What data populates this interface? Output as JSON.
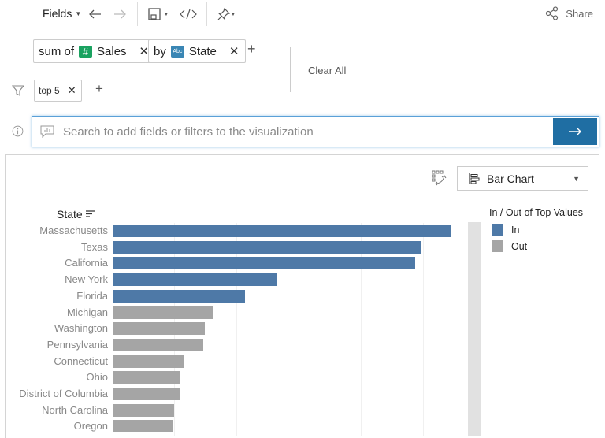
{
  "toolbar": {
    "fields_label": "Fields",
    "share_label": "Share"
  },
  "query": {
    "measure_chip": {
      "prefix": "sum of",
      "field": "Sales",
      "field_type_icon": "number-hash-icon",
      "color": "#1aa260"
    },
    "dimension_chip": {
      "prefix": "by",
      "field": "State",
      "field_type_icon": "abc-text-icon",
      "color": "#3a86b4"
    },
    "filter_chip": {
      "label": "top 5"
    },
    "clear_all_label": "Clear All"
  },
  "search": {
    "placeholder": "Search to add fields or filters to the visualization",
    "value": ""
  },
  "chart_controls": {
    "chart_type": "Bar Chart"
  },
  "colors": {
    "in": "#4e79a7",
    "out": "#a5a5a5",
    "accent": "#1f6ea3"
  },
  "chart_data": {
    "type": "bar",
    "orientation": "horizontal",
    "ylabel": "State",
    "xlabel": "",
    "categories": [
      "Massachusetts",
      "Texas",
      "California",
      "New York",
      "Florida",
      "Michigan",
      "Washington",
      "Pennsylvania",
      "Connecticut",
      "Ohio",
      "District of Columbia",
      "North Carolina",
      "Oregon"
    ],
    "values": [
      5.43,
      4.96,
      4.86,
      2.63,
      2.13,
      1.61,
      1.48,
      1.46,
      1.14,
      1.09,
      1.08,
      0.99,
      0.96
    ],
    "value_units": "relative (gridline steps; axis tick labels not visible)",
    "groups": [
      "In",
      "In",
      "In",
      "In",
      "In",
      "Out",
      "Out",
      "Out",
      "Out",
      "Out",
      "Out",
      "Out",
      "Out"
    ],
    "xlim": [
      0,
      5.7
    ],
    "grid": true,
    "legend": {
      "title": "In / Out of Top Values",
      "position": "right",
      "entries": [
        {
          "label": "In",
          "color": "#4e79a7"
        },
        {
          "label": "Out",
          "color": "#a5a5a5"
        }
      ]
    }
  }
}
